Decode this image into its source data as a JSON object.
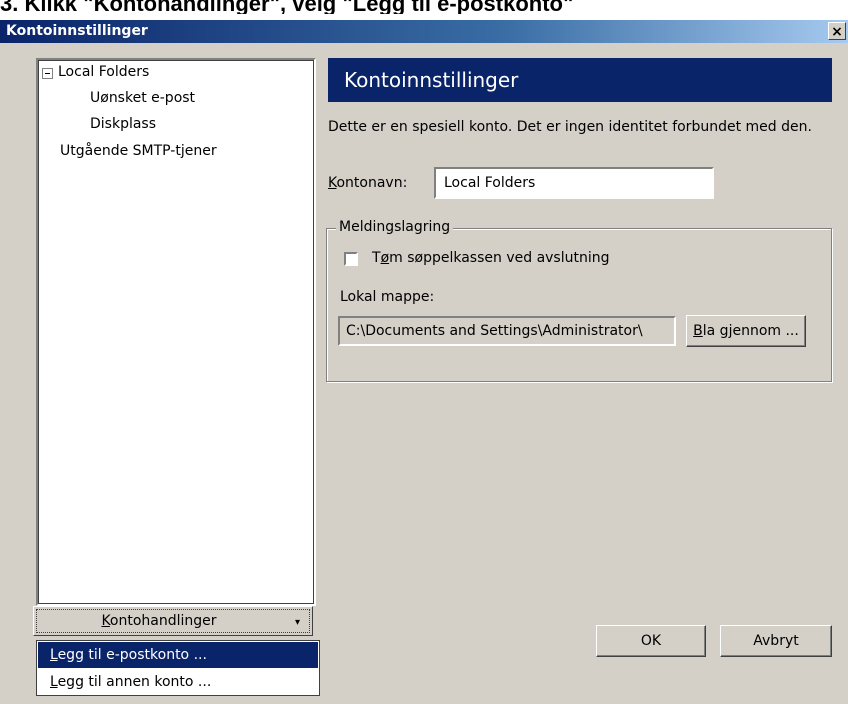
{
  "caption": {
    "text": "3. Klikk \"Kontohandlinger\", velg \"Legg til e-postkonto\""
  },
  "dialog": {
    "title": "Kontoinnstillinger",
    "close_glyph": "×"
  },
  "tree": {
    "items": [
      {
        "label": "Local Folders",
        "expanded": true
      },
      {
        "label": "Uønsket e-post"
      },
      {
        "label": "Diskplass"
      },
      {
        "label": "Utgående SMTP-tjener"
      }
    ]
  },
  "account_actions": {
    "label": "Kontohandlinger",
    "arrow": "▾",
    "menu": [
      {
        "label": "Legg til e-postkonto ...",
        "selected": true
      },
      {
        "label": "Legg til annen konto ..."
      }
    ]
  },
  "panel": {
    "header": "Kontoinnstillinger",
    "description": "Dette er en spesiell konto. Det er ingen identitet forbundet med den.",
    "account_name_label": "Kontonavn:",
    "account_name_value": "Local Folders",
    "storage_group_label": "Meldingslagring",
    "empty_trash_label": "Tøm søppelkassen ved avslutning",
    "empty_trash_checked": false,
    "local_folder_label": "Lokal mappe:",
    "local_folder_value": "C:\\Documents and Settings\\Administrator\\",
    "browse_label": "Bla gjennom ..."
  },
  "buttons": {
    "ok": "OK",
    "cancel": "Avbryt"
  },
  "colors": {
    "title_bar": "#0a246a",
    "dialog_bg": "#d4d0c8",
    "selection": "#0a246a"
  }
}
